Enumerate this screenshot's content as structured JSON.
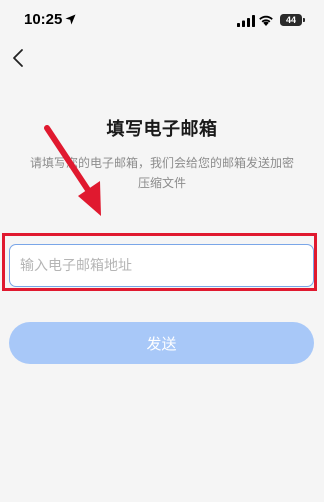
{
  "status_bar": {
    "time": "10:25",
    "battery": "44"
  },
  "nav": {
    "back_icon": "chevron-left-icon"
  },
  "page": {
    "title": "填写电子邮箱",
    "subtitle_line1": "请填写您的电子邮箱，我们会给您的邮箱发送加密",
    "subtitle_line2": "压缩文件"
  },
  "form": {
    "email_placeholder": "输入电子邮箱地址",
    "email_value": "",
    "send_label": "发送"
  },
  "annotation": {
    "arrow_color": "#e0192f",
    "highlight_color": "#e0192f"
  },
  "colors": {
    "background": "#f5f5f5",
    "button_disabled": "#a8c8f8",
    "input_border": "#7aa6e8",
    "hint_text": "#8c8c8c"
  }
}
